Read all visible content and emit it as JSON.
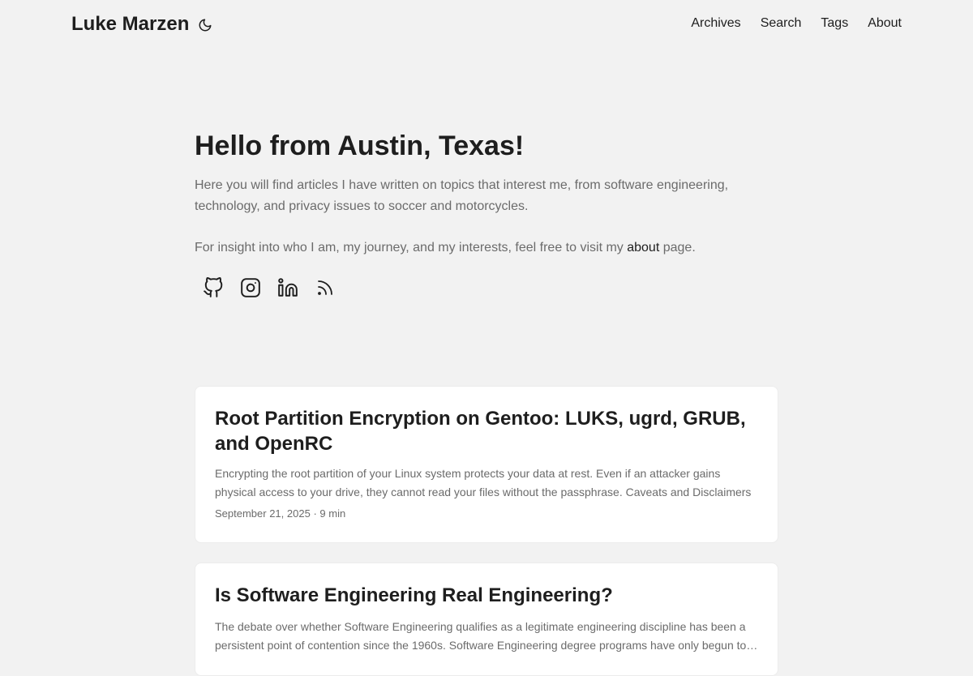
{
  "header": {
    "site_title": "Luke Marzen",
    "theme_toggle_icon": "moon-icon",
    "menu": [
      {
        "label": "Archives"
      },
      {
        "label": "Search"
      },
      {
        "label": "Tags"
      },
      {
        "label": "About"
      }
    ]
  },
  "hero": {
    "title": "Hello from Austin, Texas!",
    "intro": "Here you will find articles I have written on topics that interest me, from software engineering, technology, and privacy issues to soccer and motorcycles.",
    "about_prefix": "For insight into who I am, my journey, and my interests, feel free to visit my ",
    "about_link": "about",
    "about_suffix": " page.",
    "social_icons": [
      "github-icon",
      "instagram-icon",
      "linkedin-icon",
      "rss-icon"
    ]
  },
  "posts": [
    {
      "title": "Root Partition Encryption on Gentoo: LUKS, ugrd, GRUB, and OpenRC",
      "excerpt": "Encrypting the root partition of your Linux system protects your data at rest. Even if an attacker gains physical access to your drive, they cannot read your files without the passphrase. Caveats and Disclaimers",
      "date": "September 21, 2025",
      "separator": "·",
      "reading_time": "9 min"
    },
    {
      "title": "Is Software Engineering Real Engineering?",
      "excerpt": "The debate over whether Software Engineering qualifies as a legitimate engineering discipline has been a persistent point of contention since the 1960s. Software Engineering degree programs have only begun to appear in recent decades",
      "date": "",
      "separator": "",
      "reading_time": ""
    }
  ]
}
